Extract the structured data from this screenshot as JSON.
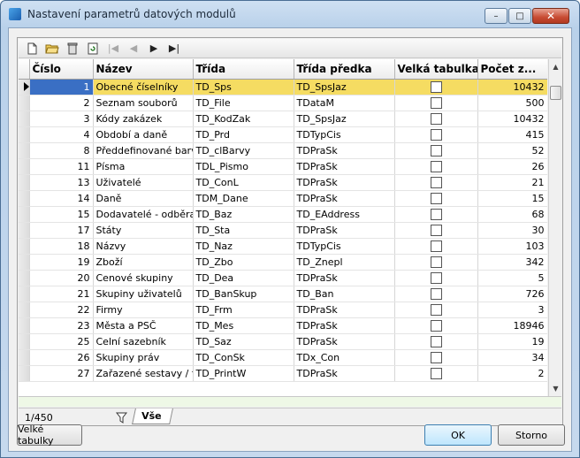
{
  "window": {
    "title": "Nastavení parametrů datových modulů",
    "minimize": "–",
    "maximize": "□",
    "close": "✕"
  },
  "toolbar": {
    "icons": [
      "new-icon",
      "open-folder-icon",
      "delete-icon",
      "refresh-icon",
      "first-record-icon",
      "prev-record-icon",
      "next-record-icon",
      "last-record-icon"
    ]
  },
  "grid": {
    "columns": [
      "Číslo",
      "Název",
      "Třída",
      "Třída předka",
      "Velká tabulka",
      "Počet z..."
    ],
    "rows": [
      {
        "cislo": "1",
        "nazev": "Obecné číselníky",
        "trida": "TD_Sps",
        "predek": "TD_SpsJaz",
        "pocet": "10432"
      },
      {
        "cislo": "2",
        "nazev": "Seznam souborů",
        "trida": "TD_File",
        "predek": "TDataM",
        "pocet": "500"
      },
      {
        "cislo": "3",
        "nazev": "Kódy zakázek",
        "trida": "TD_KodZak",
        "predek": "TD_SpsJaz",
        "pocet": "10432"
      },
      {
        "cislo": "4",
        "nazev": "Období a daně",
        "trida": "TD_Prd",
        "predek": "TDTypCis",
        "pocet": "415"
      },
      {
        "cislo": "8",
        "nazev": "Předdefinované barvy",
        "trida": "TD_clBarvy",
        "predek": "TDPraSk",
        "pocet": "52"
      },
      {
        "cislo": "11",
        "nazev": "Písma",
        "trida": "TDL_Pismo",
        "predek": "TDPraSk",
        "pocet": "26"
      },
      {
        "cislo": "13",
        "nazev": "Uživatelé",
        "trida": "TD_ConL",
        "predek": "TDPraSk",
        "pocet": "21"
      },
      {
        "cislo": "14",
        "nazev": "Daně",
        "trida": "TDM_Dane",
        "predek": "TDPraSk",
        "pocet": "15"
      },
      {
        "cislo": "15",
        "nazev": "Dodavatelé - odběratelé",
        "trida": "TD_Baz",
        "predek": "TD_EAddress",
        "pocet": "68"
      },
      {
        "cislo": "17",
        "nazev": "Státy",
        "trida": "TD_Sta",
        "predek": "TDPraSk",
        "pocet": "30"
      },
      {
        "cislo": "18",
        "nazev": "Názvy",
        "trida": "TD_Naz",
        "predek": "TDTypCis",
        "pocet": "103"
      },
      {
        "cislo": "19",
        "nazev": "Zboží",
        "trida": "TD_Zbo",
        "predek": "TD_Znepl",
        "pocet": "342"
      },
      {
        "cislo": "20",
        "nazev": "Cenové skupiny",
        "trida": "TD_Dea",
        "predek": "TDPraSk",
        "pocet": "5"
      },
      {
        "cislo": "21",
        "nazev": "Skupiny uživatelů",
        "trida": "TD_BanSkup",
        "predek": "TD_Ban",
        "pocet": "726"
      },
      {
        "cislo": "22",
        "nazev": "Firmy",
        "trida": "TD_Frm",
        "predek": "TDPraSk",
        "pocet": "3"
      },
      {
        "cislo": "23",
        "nazev": "Města a PSČ",
        "trida": "TD_Mes",
        "predek": "TDPraSk",
        "pocet": "18946"
      },
      {
        "cislo": "25",
        "nazev": "Celní sazebník",
        "trida": "TD_Saz",
        "predek": "TDPraSk",
        "pocet": "19"
      },
      {
        "cislo": "26",
        "nazev": "Skupiny práv",
        "trida": "TD_ConSk",
        "predek": "TDx_Con",
        "pocet": "34"
      },
      {
        "cislo": "27",
        "nazev": "Zařazené sestavy / funkce",
        "trida": "TD_PrintW",
        "predek": "TDPraSk",
        "pocet": "2"
      }
    ]
  },
  "status": {
    "position": "1/450",
    "tab_label": "Vše"
  },
  "buttons": {
    "big_tables": "Velké tabulky",
    "ok": "OK",
    "cancel": "Storno"
  },
  "colors": {
    "selected_row": "#f5dc62",
    "selected_cell": "#3a6fc4"
  }
}
